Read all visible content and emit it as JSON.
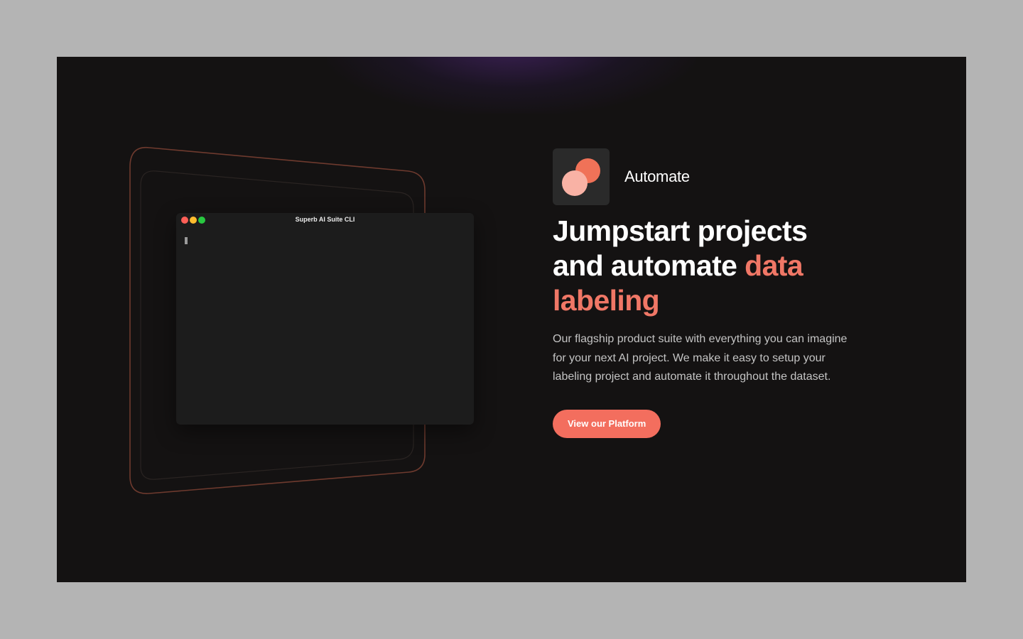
{
  "terminal": {
    "title": "Superb AI Suite CLI"
  },
  "feature": {
    "badge_label": "Automate",
    "headline_part1": "Jumpstart projects and automate ",
    "headline_accent": "data labeling",
    "description": "Our flagship product suite with everything you can imagine for your next AI project. We make it easy to setup your labeling project and automate it throughout the dataset.",
    "cta_label": "View our Platform"
  },
  "colors": {
    "accent": "#f07766",
    "button": "#f36e5e",
    "background": "#141212"
  }
}
